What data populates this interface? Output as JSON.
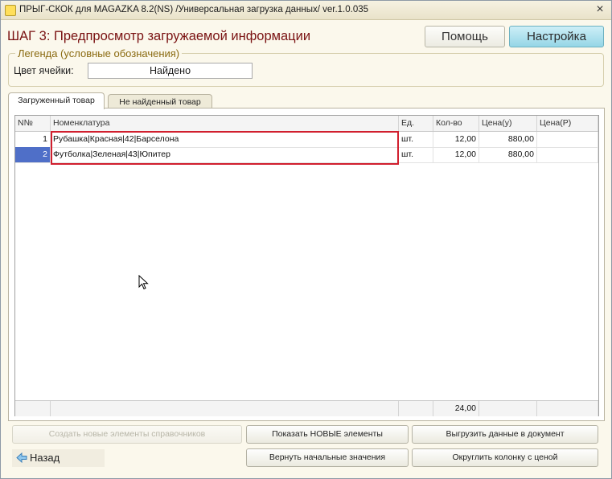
{
  "window": {
    "title": "ПРЫГ-СКОК для MAGAZKA 8.2(NS)  /Универсальная загрузка данных/ ver.1.0.035",
    "close_label": "×"
  },
  "header": {
    "step_title": "ШАГ 3: Предпросмотр загружаемой информации",
    "help_label": "Помощь",
    "settings_label": "Настройка"
  },
  "legend": {
    "title": "Легенда (условные обозначения)",
    "cell_color_label": "Цвет ячейки:",
    "cell_color_value": "Найдено"
  },
  "tabs": [
    {
      "label": "Загруженный товар",
      "active": true
    },
    {
      "label": "Не найденный товар",
      "active": false
    }
  ],
  "table": {
    "columns": [
      "N№",
      "Номенклатура",
      "Ед.",
      "Кол-во",
      "Цена(у)",
      "Цена(Р)"
    ],
    "rows": [
      {
        "num": "1",
        "name": "Рубашка|Красная|42|Барселона",
        "unit": "шт.",
        "qty": "12,00",
        "price_y": "880,00",
        "price_r": ""
      },
      {
        "num": "2",
        "name": "Футболка|Зеленая|43|Юпитер",
        "unit": "шт.",
        "qty": "12,00",
        "price_y": "880,00",
        "price_r": ""
      }
    ],
    "selected_row": 2,
    "total_qty": "24,00"
  },
  "buttons": {
    "create_new": "Создать новые элементы справочников",
    "show_new": "Показать НОВЫЕ элементы",
    "export_doc": "Выгрузить данные в документ",
    "back": "Назад",
    "reset": "Вернуть начальные значения",
    "round_price": "Округлить колонку с ценой"
  },
  "colors": {
    "accent_title": "#7a1212",
    "legend_title": "#8a6a10",
    "highlight": "#d11f2e",
    "selected_row": "#4f6fc8"
  }
}
